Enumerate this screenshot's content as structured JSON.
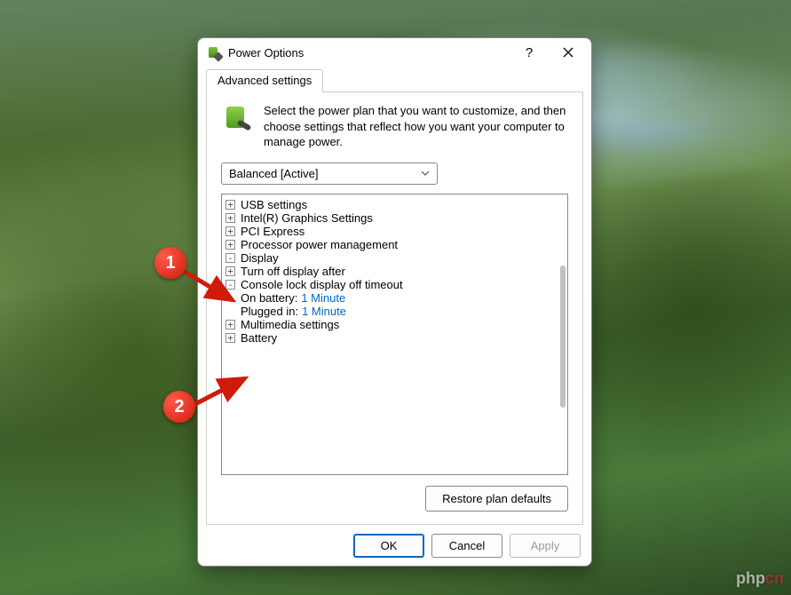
{
  "window": {
    "title": "Power Options",
    "help_tooltip": "?",
    "tab_label": "Advanced settings",
    "intro_text": "Select the power plan that you want to customize, and then choose settings that reflect how you want your computer to manage power.",
    "plan_selected": "Balanced [Active]",
    "restore_button": "Restore plan defaults"
  },
  "tree": {
    "usb": "USB settings",
    "intel": "Intel(R) Graphics Settings",
    "pci": "PCI Express",
    "processor": "Processor power management",
    "display": "Display",
    "turn_off": "Turn off display after",
    "console_lock": "Console lock display off timeout",
    "on_battery_label": "On battery:",
    "on_battery_value": "1 Minute",
    "plugged_in_label": "Plugged in:",
    "plugged_in_value": "1 Minute",
    "multimedia": "Multimedia settings",
    "battery": "Battery"
  },
  "footer": {
    "ok": "OK",
    "cancel": "Cancel",
    "apply": "Apply"
  },
  "annotations": {
    "badge1": "1",
    "badge2": "2"
  },
  "watermark": {
    "brand": "php",
    "suffix": "cn"
  }
}
